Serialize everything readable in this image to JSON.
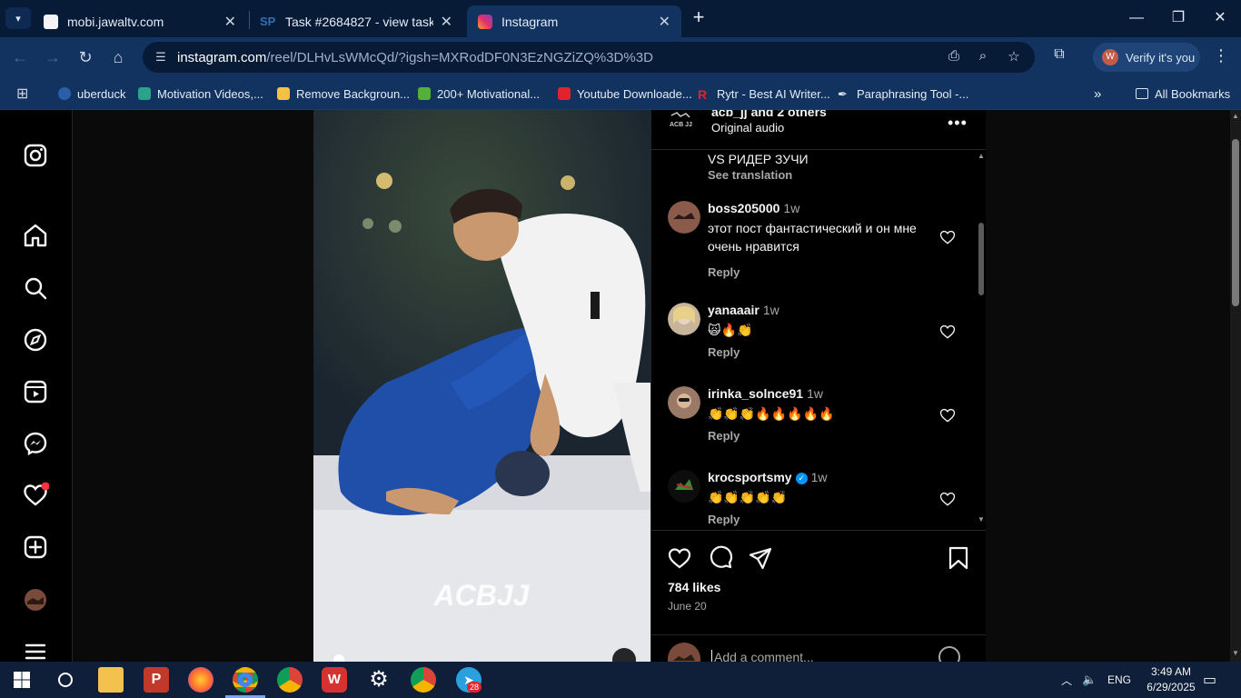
{
  "browser": {
    "tabs": [
      {
        "title": "mobi.jawaltv.com",
        "active": false
      },
      {
        "title": "Task #2684827 - view task",
        "active": false
      },
      {
        "title": "Instagram",
        "active": true
      }
    ],
    "url": {
      "host": "instagram.com",
      "path": "/reel/DLHvLsWMcQd/?igsh=MXRodDF0N3EzNGZiZQ%3D%3D"
    },
    "verify_label": "Verify it's you",
    "bookmarks": [
      "uberduck",
      "Motivation Videos,...",
      "Remove Backgroun...",
      "200+ Motivational...",
      "Youtube Downloade...",
      "Rytr - Best AI Writer...",
      "Paraphrasing Tool -..."
    ],
    "all_bookmarks_label": "All Bookmarks"
  },
  "post": {
    "header": {
      "user": "acb_jj and 2 others",
      "audio": "Original audio",
      "logo_text": "ACB JJ"
    },
    "caption": "VS РИДЕР ЗУЧИ",
    "see_translation": "See translation",
    "comments": [
      {
        "user": "boss205000",
        "time": "1w",
        "text": "этот пост фантастический и он мне очень нравится",
        "reply": "Reply",
        "verified": false
      },
      {
        "user": "yanaaair",
        "time": "1w",
        "text": "🙀🔥👏",
        "reply": "Reply",
        "verified": false
      },
      {
        "user": "irinka_solnce91",
        "time": "1w",
        "text": "👏👏👏🔥🔥🔥🔥🔥",
        "reply": "Reply",
        "verified": false
      },
      {
        "user": "krocsportsmy",
        "time": "1w",
        "text": "👏👏👏👏👏",
        "reply": "Reply",
        "verified": true
      }
    ],
    "likes": "784 likes",
    "date": "June 20",
    "comment_placeholder": "Add a comment...",
    "media_watermark": "ACBJJ"
  },
  "taskbar": {
    "language": "ENG",
    "time": "3:49 AM",
    "date": "6/29/2025",
    "telegram_badge": "28"
  },
  "colors": {
    "chrome_dark": "#071a36",
    "chrome": "#12325f",
    "ig_bg": "#000000",
    "ig_text": "#f5f5f5",
    "ig_secondary": "#a8a8a8",
    "notification_dot": "#ff3040",
    "verified": "#0095f6"
  }
}
